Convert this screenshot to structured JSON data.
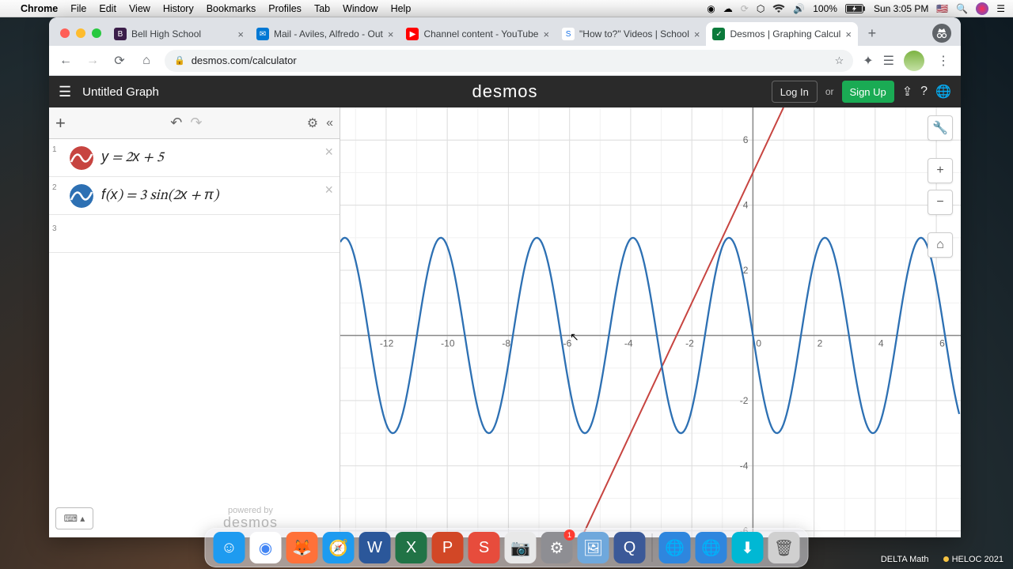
{
  "mac_menu": {
    "app": "Chrome",
    "items": [
      "File",
      "Edit",
      "View",
      "History",
      "Bookmarks",
      "Profiles",
      "Tab",
      "Window",
      "Help"
    ],
    "battery": "100%",
    "clock": "Sun 3:05 PM"
  },
  "browser": {
    "tabs": [
      {
        "label": "Bell High School",
        "fav_bg": "#3b1e4a",
        "fav_txt": "B"
      },
      {
        "label": "Mail - Aviles, Alfredo - Out",
        "fav_bg": "#0078d4",
        "fav_txt": "✉"
      },
      {
        "label": "Channel content - YouTube",
        "fav_bg": "#ff0000",
        "fav_txt": "▶"
      },
      {
        "label": "\"How to?\" Videos | School",
        "fav_bg": "#ffffff",
        "fav_txt": "S",
        "fav_color": "#1a73e8"
      },
      {
        "label": "Desmos | Graphing Calcul",
        "fav_bg": "#0b7a3b",
        "fav_txt": "✓",
        "active": true
      }
    ],
    "url": "desmos.com/calculator"
  },
  "desmos": {
    "title": "Untitled Graph",
    "brand": "desmos",
    "login": "Log In",
    "or": "or",
    "signup": "Sign Up",
    "expressions": [
      {
        "index": "1",
        "color": "#c74440",
        "latex": "y = 2x + 5"
      },
      {
        "index": "2",
        "color": "#2d70b3",
        "latex": "f(x)  =  3 sin(2x + π)"
      }
    ],
    "powered_by": "powered by",
    "powered_brand": "desmos"
  },
  "chart_data": {
    "type": "line",
    "title": "",
    "xlabel": "",
    "ylabel": "",
    "xlim": [
      -13.5,
      6.8
    ],
    "ylim": [
      -6.2,
      7.0
    ],
    "xticks": [
      -12,
      -10,
      -8,
      -6,
      -4,
      -2,
      0,
      2,
      4,
      6
    ],
    "yticks": [
      -6,
      -4,
      -2,
      2,
      4,
      6
    ],
    "series": [
      {
        "name": "y = 2x + 5",
        "color": "#c74440",
        "kind": "line",
        "equation": "y=2x+5",
        "points": [
          [
            -6.1,
            -7.2
          ],
          [
            1.0,
            7.0
          ]
        ]
      },
      {
        "name": "f(x) = 3 sin(2x + π)",
        "color": "#2d70b3",
        "kind": "sine",
        "amplitude": 3,
        "angular_freq": 2,
        "phase": 3.14159,
        "voffset": 0
      }
    ]
  },
  "graph_tools": {
    "wrench": "🔧",
    "plus": "+",
    "minus": "−",
    "home": "⌂"
  },
  "dock": {
    "apps": [
      {
        "name": "finder",
        "bg": "#1e9bf0",
        "glyph": "☺"
      },
      {
        "name": "chrome",
        "bg": "#ffffff",
        "glyph": "◉",
        "color": "#4285f4"
      },
      {
        "name": "firefox",
        "bg": "#ff7139",
        "glyph": "🦊"
      },
      {
        "name": "safari",
        "bg": "#1e9bf0",
        "glyph": "🧭"
      },
      {
        "name": "word",
        "bg": "#2b579a",
        "glyph": "W"
      },
      {
        "name": "excel",
        "bg": "#217346",
        "glyph": "X"
      },
      {
        "name": "powerpoint",
        "bg": "#d24726",
        "glyph": "P"
      },
      {
        "name": "app-red",
        "bg": "#e74c3c",
        "glyph": "S"
      },
      {
        "name": "photo-booth",
        "bg": "#e8e8e8",
        "glyph": "📷",
        "color": "#555"
      },
      {
        "name": "settings",
        "bg": "#8e8e93",
        "glyph": "⚙",
        "badge": "1"
      },
      {
        "name": "preview",
        "bg": "#6fa8dc",
        "glyph": "🖼"
      },
      {
        "name": "quicktime",
        "bg": "#3b5998",
        "glyph": "Q"
      }
    ],
    "apps_right": [
      {
        "name": "globe1",
        "bg": "#2e86de",
        "glyph": "🌐"
      },
      {
        "name": "globe2",
        "bg": "#2e86de",
        "glyph": "🌐"
      },
      {
        "name": "download",
        "bg": "#00b8d4",
        "glyph": "⬇"
      },
      {
        "name": "trash",
        "bg": "#d0d0d0",
        "glyph": "🗑",
        "color": "#555"
      }
    ]
  },
  "taskbar": {
    "label1": "DELTA Math",
    "label2": "HELOC 2021"
  }
}
